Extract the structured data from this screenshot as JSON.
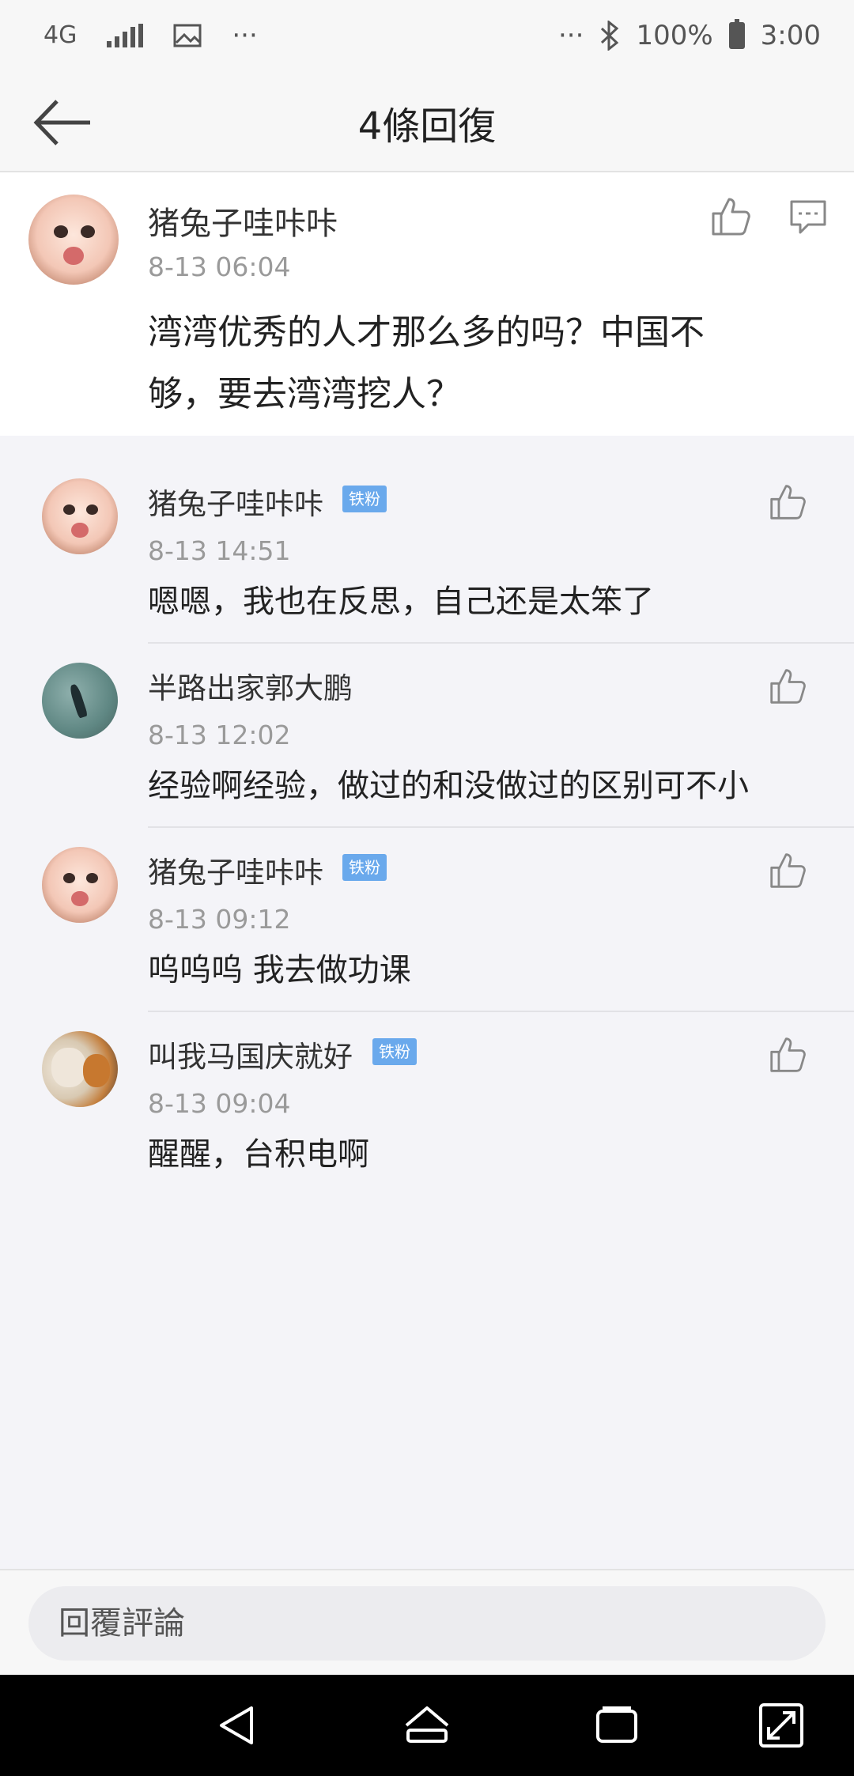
{
  "status_bar": {
    "network": "4G",
    "more_left": "···",
    "more_right": "···",
    "battery": "100%",
    "time": "3:00"
  },
  "header": {
    "title": "4條回復"
  },
  "main_comment": {
    "username": "猪兔子哇咔咔",
    "time": "8-13 06:04",
    "content_line1": "湾湾优秀的人才那么多的吗？中国不",
    "content_line2": "够，要去湾湾挖人？"
  },
  "replies": [
    {
      "username": "猪兔子哇咔咔",
      "badge": "铁粉",
      "time": "8-13 14:51",
      "content": "嗯嗯，我也在反思，自己还是太笨了"
    },
    {
      "username": "半路出家郭大鹏",
      "badge": "",
      "time": "8-13 12:02",
      "content": "经验啊经验，做过的和没做过的区别可不小"
    },
    {
      "username": "猪兔子哇咔咔",
      "badge": "铁粉",
      "time": "8-13 09:12",
      "content": "呜呜呜 我去做功课"
    },
    {
      "username": "叫我马国庆就好",
      "badge": "铁粉",
      "time": "8-13 09:04",
      "content": "醒醒，台积电啊"
    }
  ],
  "reply_input": {
    "placeholder": "回覆評論"
  },
  "colors": {
    "background": "#f4f4f8",
    "badge": "#6aa9ec",
    "time_text": "#9a9a9a"
  },
  "icons": {
    "back": "arrow-left-icon",
    "like": "thumbs-up-icon",
    "comment": "comment-icon"
  }
}
